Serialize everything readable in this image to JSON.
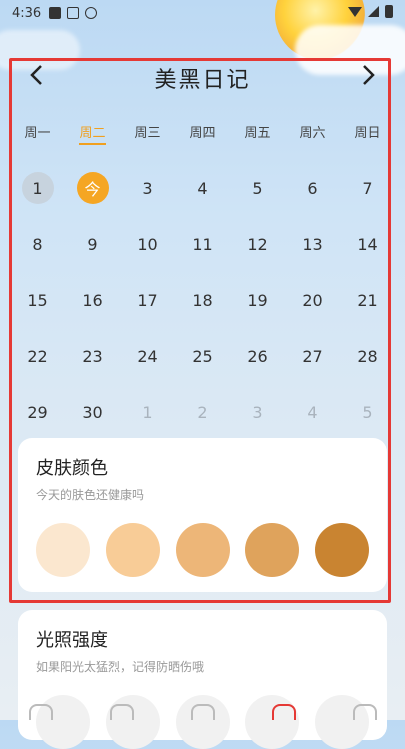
{
  "status_bar": {
    "time": "4:36"
  },
  "header": {
    "title": "美黑日记",
    "prev_icon": "chevron-left-icon",
    "next_icon": "chevron-right-icon"
  },
  "weekdays": [
    "周一",
    "周二",
    "周三",
    "周四",
    "周五",
    "周六",
    "周日"
  ],
  "calendar": {
    "rows": [
      [
        "1",
        "今",
        "3",
        "4",
        "5",
        "6",
        "7"
      ],
      [
        "8",
        "9",
        "10",
        "11",
        "12",
        "13",
        "14"
      ],
      [
        "15",
        "16",
        "17",
        "18",
        "19",
        "20",
        "21"
      ],
      [
        "22",
        "23",
        "24",
        "25",
        "26",
        "27",
        "28"
      ],
      [
        "29",
        "30",
        "1",
        "2",
        "3",
        "4",
        "5"
      ]
    ]
  },
  "skin_card": {
    "title": "皮肤颜色",
    "subtitle": "今天的肤色还健康吗",
    "colors": [
      "#fbe7cf",
      "#f8cc97",
      "#edb678",
      "#dfa35c",
      "#c98431"
    ]
  },
  "light_card": {
    "title": "光照强度",
    "subtitle": "如果阳光太猛烈，记得防晒伤哦"
  },
  "colors": {
    "accent": "#f5a623",
    "highlight": "#e53935"
  }
}
